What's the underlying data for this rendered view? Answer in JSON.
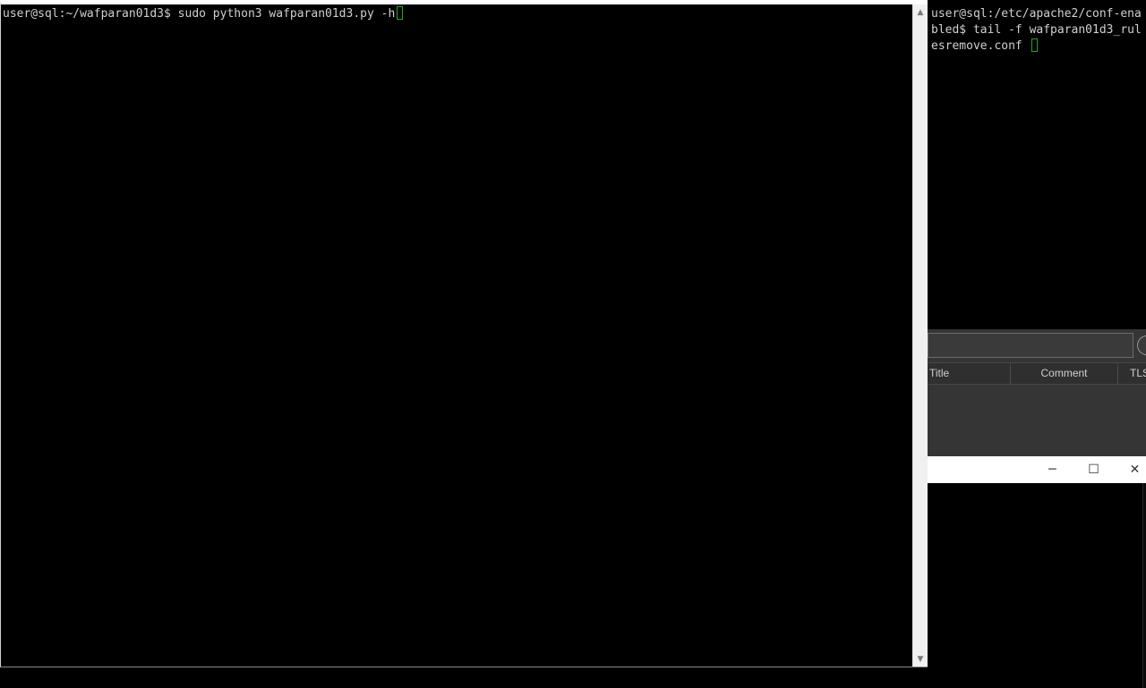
{
  "right_terminal": {
    "lines": [
      "user@sql:/etc/apache2/conf-ena",
      "bled$ tail -f wafparan01d3_rul",
      "esremove.conf "
    ]
  },
  "bg_app": {
    "columns": [
      "Title",
      "Comment",
      "TLS"
    ]
  },
  "bg_window": {
    "controls": {
      "minimize": "─",
      "maximize": "☐",
      "close": "✕"
    }
  },
  "main_terminal": {
    "prompt": "user@sql:~/wafparan01d3$ ",
    "command": "sudo python3 wafparan01d3.py -h"
  },
  "scrollbar": {
    "up_arrow": "▲",
    "down_arrow": "▼"
  },
  "colors": {
    "terminal_bg": "#000000",
    "terminal_fg": "#d0d0d0",
    "cursor_outline": "#2aa12a",
    "titlebar": "#ffffff",
    "scrollbar_bg": "#f0f0f0"
  }
}
